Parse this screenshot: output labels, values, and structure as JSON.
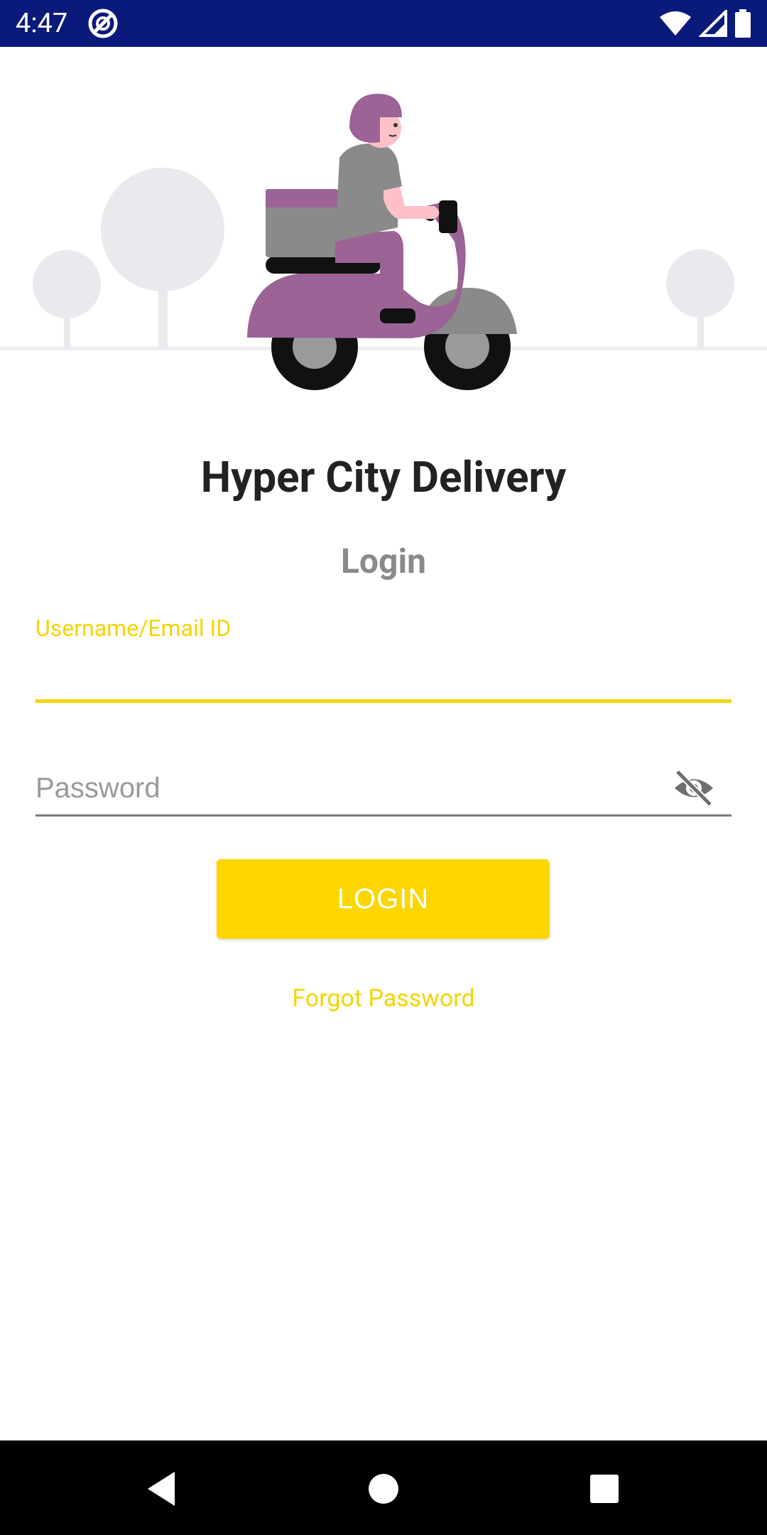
{
  "status_bar": {
    "time": "4:47",
    "icons": [
      "app-notification-icon",
      "wifi-icon",
      "signal-icon",
      "battery-icon"
    ]
  },
  "app": {
    "title": "Hyper City Delivery",
    "login_heading": "Login"
  },
  "form": {
    "username_label": "Username/Email ID",
    "username_value": "",
    "password_placeholder": "Password",
    "password_value": "",
    "login_button": "LOGIN",
    "forgot_password": "Forgot Password"
  },
  "navigation": {
    "buttons": [
      "back-icon",
      "home-icon",
      "recents-icon"
    ]
  },
  "colors": {
    "status_bar": "#0a1a7a",
    "accent_yellow": "#fdd600",
    "scooter_purple": "#9b6396",
    "nav_bar": "#000000"
  }
}
